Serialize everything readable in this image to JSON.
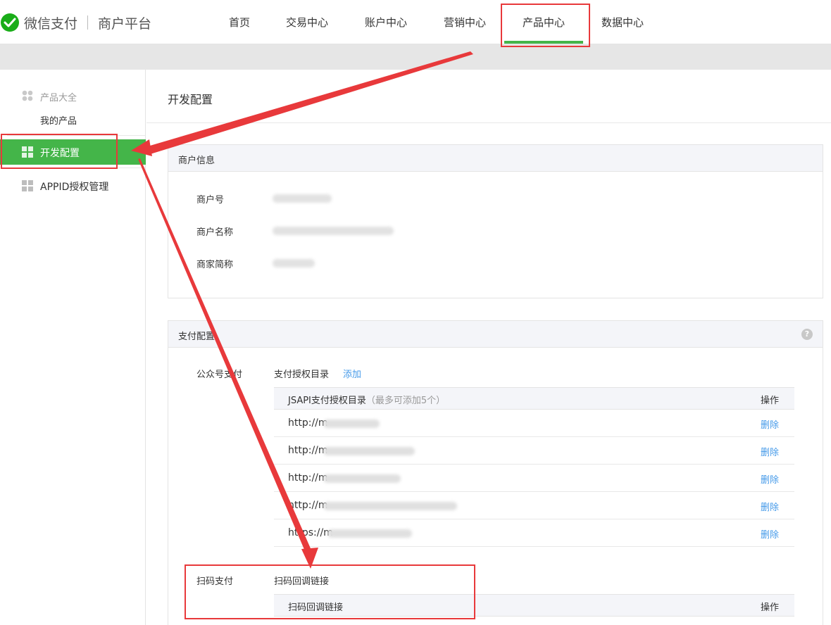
{
  "header": {
    "brand": "微信支付",
    "platform": "商户平台",
    "nav": [
      "首页",
      "交易中心",
      "账户中心",
      "营销中心",
      "产品中心",
      "数据中心"
    ],
    "active_nav": "产品中心"
  },
  "sidebar": {
    "group_title": "产品大全",
    "my_products": "我的产品",
    "active_item": "开发配置",
    "appid_item": "APPID授权管理"
  },
  "main": {
    "page_title": "开发配置",
    "merchant_info": {
      "title": "商户信息",
      "rows": [
        {
          "label": "商户号"
        },
        {
          "label": "商户名称"
        },
        {
          "label": "商家简称"
        }
      ]
    },
    "payment_config": {
      "title": "支付配置",
      "help": "?",
      "jsapi": {
        "section_label": "公众号支付",
        "dir_label": "支付授权目录",
        "add_link": "添加",
        "col_header": "JSAPI支付授权目录",
        "col_note": "（最多可添加5个）",
        "op_header": "操作",
        "rows": [
          {
            "prefix": "http://m",
            "action": "删除"
          },
          {
            "prefix": "http://m",
            "action": "删除"
          },
          {
            "prefix": "http://m",
            "action": "删除"
          },
          {
            "prefix": "http://m",
            "action": "删除"
          },
          {
            "prefix": "https://m",
            "action": "删除"
          }
        ]
      },
      "native": {
        "section_label": "扫码支付",
        "callback_label": "扫码回调链接",
        "col_header": "扫码回调链接",
        "op_header": "操作"
      }
    }
  },
  "colors": {
    "brand_green": "#44b549",
    "link_blue": "#459ae9",
    "annotation_red": "#e8393b"
  }
}
